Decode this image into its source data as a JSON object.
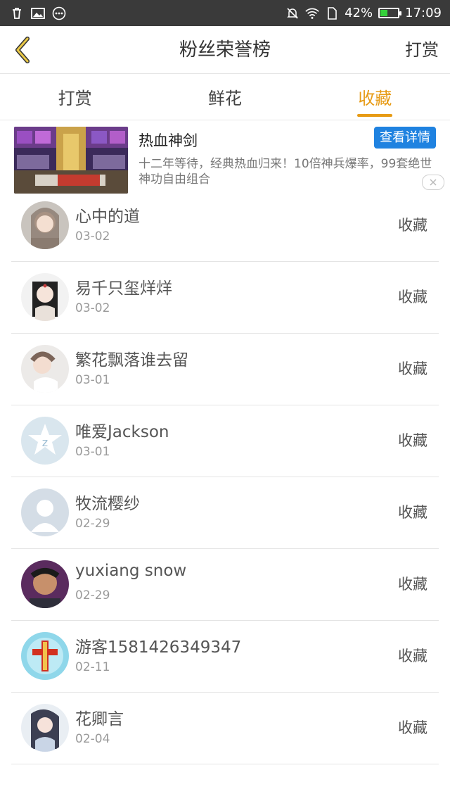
{
  "statusbar": {
    "battery": "42%",
    "time": "17:09",
    "battery_level": 0.42,
    "icons": [
      "trash-icon",
      "image-icon",
      "more-dots-icon",
      "mute-icon",
      "wifi-icon",
      "sim-icon",
      "battery-icon"
    ]
  },
  "header": {
    "title": "粉丝荣誉榜",
    "right_action": "打赏"
  },
  "tabs": [
    {
      "label": "打赏",
      "active": false
    },
    {
      "label": "鲜花",
      "active": false
    },
    {
      "label": "收藏",
      "active": true
    }
  ],
  "ad": {
    "title": "热血神剑",
    "button": "查看详情",
    "description": "十二年等待，经典热血归来！10倍神兵爆率，99套绝世神功自由组合"
  },
  "list": [
    {
      "name": "心中的道",
      "date": "03-02",
      "action": "收藏"
    },
    {
      "name": "易千只玺烊烊",
      "date": "03-02",
      "action": "收藏"
    },
    {
      "name": "繁花飘落谁去留",
      "date": "03-01",
      "action": "收藏"
    },
    {
      "name": "唯爱Jackson",
      "date": "03-01",
      "action": "收藏"
    },
    {
      "name": "牧流樱纱",
      "date": "02-29",
      "action": "收藏"
    },
    {
      "name": "yuxiang snow",
      "date": "02-29",
      "action": "收藏"
    },
    {
      "name": "游客1581426349347",
      "date": "02-11",
      "action": "收藏"
    },
    {
      "name": "花卿言",
      "date": "02-04",
      "action": "收藏"
    }
  ],
  "colors": {
    "accent": "#e79b15",
    "statusbar": "#3a3a3a",
    "ad_button": "#1f82e0"
  }
}
